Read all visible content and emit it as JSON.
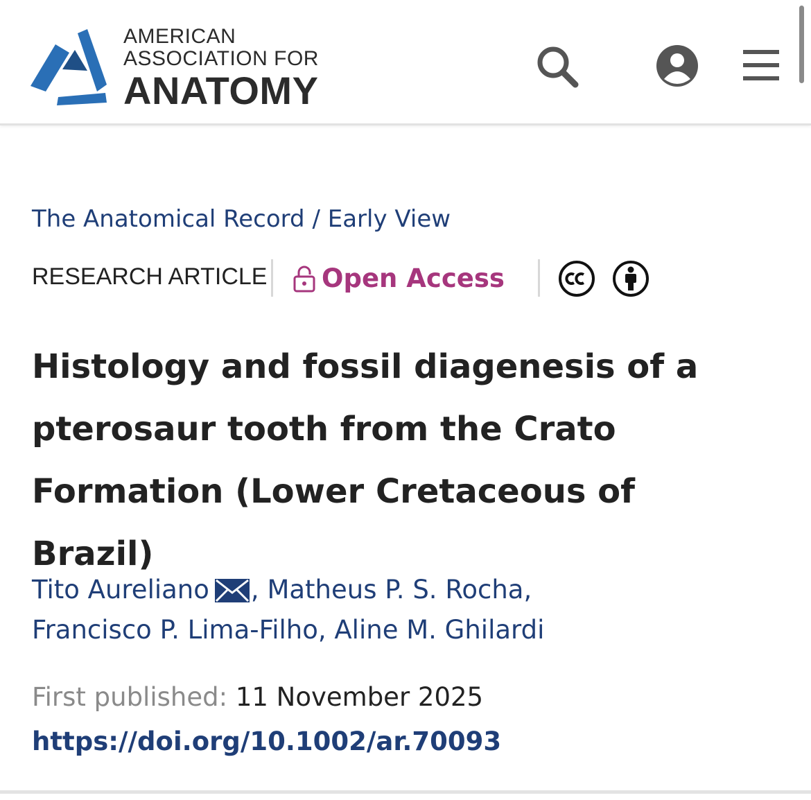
{
  "brand": {
    "line1": "AMERICAN",
    "line2": "ASSOCIATION FOR",
    "line3": "ANATOMY",
    "icon": "aaa-triangle-logo",
    "colors": {
      "blue": "#2a6fb6",
      "dark_blue": "#1f4f86",
      "text": "#2b2b2b"
    }
  },
  "header": {
    "icons": [
      "search-icon",
      "account-icon",
      "hamburger-menu-icon"
    ]
  },
  "breadcrumb": {
    "journal": "The Anatomical Record",
    "separator": " / ",
    "section": "Early View"
  },
  "meta": {
    "article_type": "RESEARCH ARTICLE",
    "access_label": "Open Access",
    "access_icon": "lock-icon",
    "license_icons": [
      "cc-icon",
      "attribution-icon"
    ],
    "access_color": "#a6367d"
  },
  "article": {
    "title_lines": [
      "Histology and fossil diagenesis of a",
      "pterosaur tooth from the Crato",
      "Formation (Lower Cretaceous of Brazil)"
    ],
    "authors": [
      "Tito Aureliano",
      "Matheus P. S. Rocha",
      "Francisco P. Lima-Filho",
      "Aline M. Ghilardi"
    ],
    "corresponding_icon": "mail-icon",
    "separator": ",",
    "first_published_label": "First published:",
    "first_published_date": "11 November 2025",
    "doi": "https://doi.org/10.1002/ar.70093"
  },
  "colors": {
    "link": "#1f3e77",
    "muted": "#8a8a8a",
    "text": "#222222"
  }
}
